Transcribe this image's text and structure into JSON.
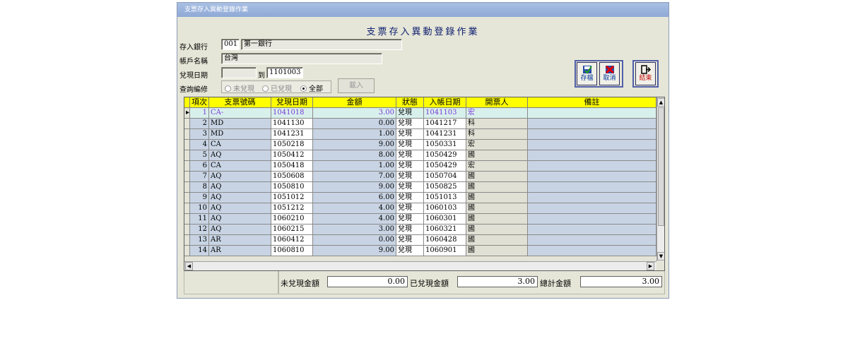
{
  "window": {
    "title": "支票存入異動登錄作業"
  },
  "heading": "支票存入異動登錄作業",
  "form": {
    "bank_label": "存入銀行",
    "bank_code": "001",
    "bank_name": "第一銀行",
    "account_label": "帳戶名稱",
    "account_name": "台灣",
    "date_label": "兌現日期",
    "date_from": "",
    "date_to_label": "到",
    "date_to": "1101003",
    "query_label": "查詢編修",
    "radio_options": [
      "未兌現",
      "已兌現",
      "全部"
    ],
    "radio_selected": "全部",
    "load_button": "載入"
  },
  "toolbar": {
    "save": "存檔",
    "cancel": "取消",
    "exit": "結束"
  },
  "table": {
    "columns": [
      "項次",
      "支票號碼",
      "兌現日期",
      "金額",
      "狀態",
      "入帳日期",
      "開票人",
      "備註"
    ],
    "rows": [
      {
        "no": "1",
        "cheque": "CA-",
        "cash_date": "1041018",
        "amount": "3.00",
        "status": "兌現",
        "entry_date": "1041103",
        "drawer": "宏",
        "note": ""
      },
      {
        "no": "2",
        "cheque": "MD",
        "cash_date": "1041130",
        "amount": "0.00",
        "status": "兌現",
        "entry_date": "1041217",
        "drawer": "科",
        "note": ""
      },
      {
        "no": "3",
        "cheque": "MD",
        "cash_date": "1041231",
        "amount": "1.00",
        "status": "兌現",
        "entry_date": "1041231",
        "drawer": "科",
        "note": ""
      },
      {
        "no": "4",
        "cheque": "CA",
        "cash_date": "1050218",
        "amount": "9.00",
        "status": "兌現",
        "entry_date": "1050331",
        "drawer": "宏",
        "note": ""
      },
      {
        "no": "5",
        "cheque": "AQ",
        "cash_date": "1050412",
        "amount": "8.00",
        "status": "兌現",
        "entry_date": "1050429",
        "drawer": "國",
        "note": ""
      },
      {
        "no": "6",
        "cheque": "CA",
        "cash_date": "1050418",
        "amount": "1.00",
        "status": "兌現",
        "entry_date": "1050429",
        "drawer": "宏",
        "note": ""
      },
      {
        "no": "7",
        "cheque": "AQ",
        "cash_date": "1050608",
        "amount": "7.00",
        "status": "兌現",
        "entry_date": "1050704",
        "drawer": "國",
        "note": ""
      },
      {
        "no": "8",
        "cheque": "AQ",
        "cash_date": "1050810",
        "amount": "9.00",
        "status": "兌現",
        "entry_date": "1050825",
        "drawer": "國",
        "note": ""
      },
      {
        "no": "9",
        "cheque": "AQ",
        "cash_date": "1051012",
        "amount": "6.00",
        "status": "兌現",
        "entry_date": "1051013",
        "drawer": "國",
        "note": ""
      },
      {
        "no": "10",
        "cheque": "AQ",
        "cash_date": "1051212",
        "amount": "4.00",
        "status": "兌現",
        "entry_date": "1060103",
        "drawer": "國",
        "note": ""
      },
      {
        "no": "11",
        "cheque": "AQ",
        "cash_date": "1060210",
        "amount": "4.00",
        "status": "兌現",
        "entry_date": "1060301",
        "drawer": "國",
        "note": ""
      },
      {
        "no": "12",
        "cheque": "AQ",
        "cash_date": "1060215",
        "amount": "3.00",
        "status": "兌現",
        "entry_date": "1060321",
        "drawer": "國",
        "note": ""
      },
      {
        "no": "13",
        "cheque": "AR",
        "cash_date": "1060412",
        "amount": "0.00",
        "status": "兌現",
        "entry_date": "1060428",
        "drawer": "國",
        "note": ""
      },
      {
        "no": "14",
        "cheque": "AR",
        "cash_date": "1060810",
        "amount": "9.00",
        "status": "兌現",
        "entry_date": "1060901",
        "drawer": "國",
        "note": ""
      }
    ]
  },
  "totals": {
    "uncashed_label": "未兌現金額",
    "uncashed": "0.00",
    "cashed_label": "已兌現金額",
    "cashed": "3.00",
    "total_label": "總計金額",
    "total": "3.00"
  },
  "colors": {
    "header_bg": "#ffff00",
    "title_bar": "#9bb3dc",
    "selected_text": "#7a3ad8"
  }
}
